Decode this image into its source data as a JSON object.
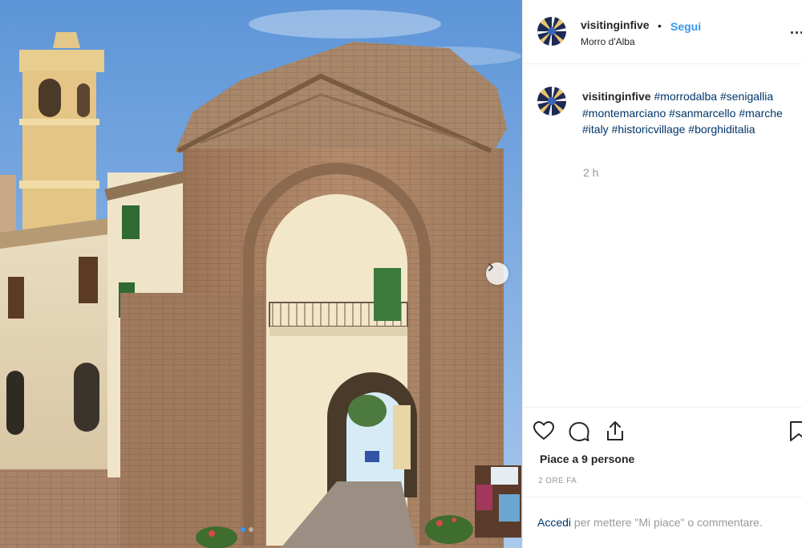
{
  "post": {
    "username": "visitinginfive",
    "bullet": "•",
    "follow_label": "Segui",
    "location": "Morro d'Alba",
    "more_label": "..."
  },
  "caption": {
    "username": "visitinginfive",
    "hashtags": [
      "#morrodalba",
      "#senigallia",
      "#montemarciano",
      "#sanmarcello",
      "#marche",
      "#italy",
      "#historicvillage",
      "#borghiditalia"
    ],
    "time": "2 h"
  },
  "actions": {
    "likes_text": "Piace a 9 persone",
    "time_ago": "2 ORE FA"
  },
  "login": {
    "link": "Accedi",
    "rest": " per mettere \"Mi piace\" o commentare."
  },
  "carousel": {
    "slide_count": 2,
    "current_slide": 1
  },
  "colors": {
    "link_blue": "#3897f0",
    "hashtag": "#003569",
    "muted": "#999999",
    "text": "#262626"
  },
  "icons": [
    "heart-icon",
    "comment-icon",
    "share-icon",
    "bookmark-icon",
    "chevron-right-icon",
    "more-icon"
  ]
}
